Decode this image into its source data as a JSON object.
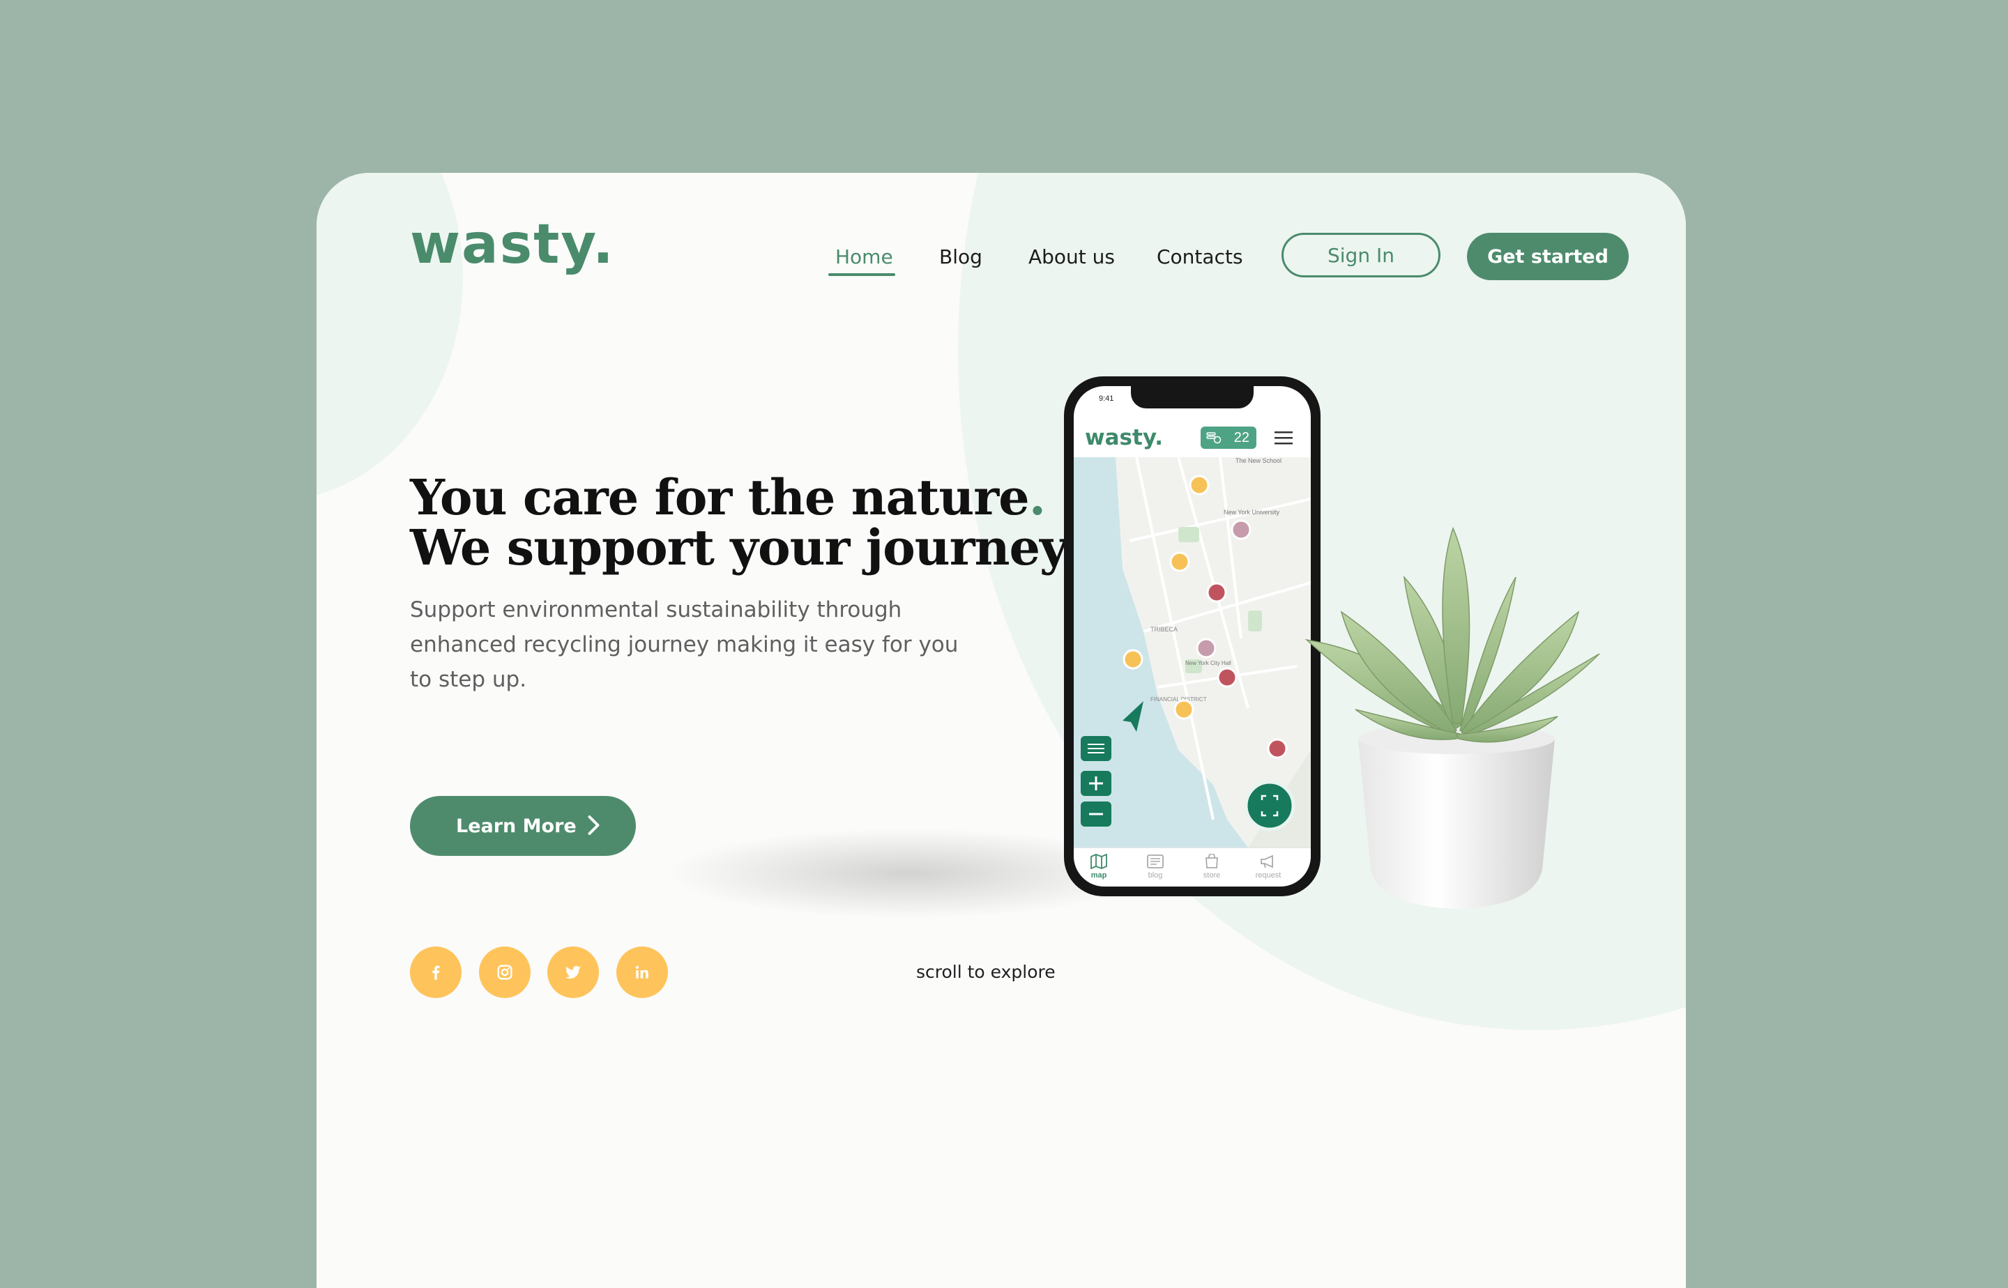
{
  "header": {
    "logo_text": "wasty",
    "logo_dot": ".",
    "nav": [
      {
        "label": "Home",
        "active": true
      },
      {
        "label": "Blog"
      },
      {
        "label": "About us"
      },
      {
        "label": "Contacts"
      }
    ],
    "sign_in": "Sign In",
    "get_started": "Get started"
  },
  "hero": {
    "line1": "You care for the nature",
    "line2": "We support your journey",
    "accent_dot": ".",
    "subtitle": "Support environmental sustainability through enhanced recycling journey making it easy for you to step up.",
    "cta": "Learn More"
  },
  "socials": [
    "facebook-icon",
    "instagram-icon",
    "twitter-icon",
    "linkedin-icon"
  ],
  "scroll_hint": "scroll to explore",
  "phone": {
    "time": "9:41",
    "app_logo": "wasty",
    "app_logo_dot": ".",
    "badge_count": "22",
    "map_labels": {
      "new_school": "The New School",
      "nyu": "New York University",
      "tribeca": "TRIBECA",
      "city_hall": "New York City Hall",
      "financial": "FINANCIAL DISTRICT"
    },
    "tabs": [
      "map",
      "blog",
      "store",
      "request"
    ]
  },
  "colors": {
    "brand": "#4a8b6c",
    "accent_yellow": "#fec45b",
    "background": "#9db5a9",
    "card": "#fbfbfa",
    "soft_green": "#edf5f0"
  }
}
